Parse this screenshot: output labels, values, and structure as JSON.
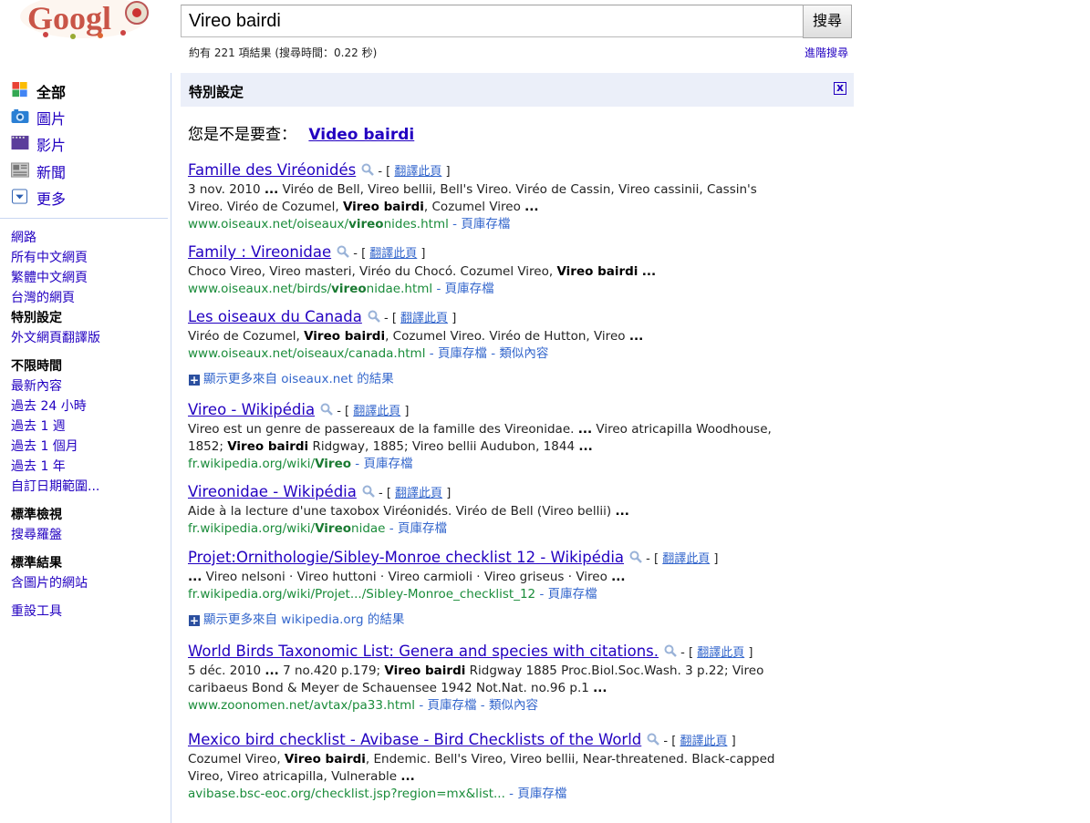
{
  "search": {
    "query": "Vireo bairdi",
    "button_label": "搜尋"
  },
  "stats": "約有 221 項結果 (搜尋時間：0.22 秒)",
  "advanced_search": "進階搜尋",
  "nav": {
    "main": [
      {
        "label": "全部",
        "icon": "google-all-icon"
      },
      {
        "label": "圖片",
        "icon": "camera-icon"
      },
      {
        "label": "影片",
        "icon": "film-icon"
      },
      {
        "label": "新聞",
        "icon": "newspaper-icon"
      },
      {
        "label": "更多",
        "icon": "dropdown-icon"
      }
    ],
    "web": [
      "網路",
      "所有中文網頁",
      "繁體中文網頁",
      "台灣的網頁"
    ],
    "special_settings": "特別設定",
    "translated": "外文網頁翻譯版",
    "time_head": "不限時間",
    "time": [
      "最新內容",
      "過去 24 小時",
      "過去 1 週",
      "過去 1 個月",
      "過去 1 年",
      "自訂日期範圍..."
    ],
    "view_head": "標準檢視",
    "view": [
      "搜尋羅盤"
    ],
    "results_head": "標準結果",
    "results": [
      "含圖片的網站"
    ],
    "reset": "重設工具"
  },
  "settings_bar": {
    "title": "特別設定",
    "close": "x"
  },
  "did_you_mean": {
    "prefix": "您是不是要查：",
    "suggestion": "Video bairdi"
  },
  "translate_label": "翻譯此頁",
  "cache_label": "頁庫存檔",
  "similar_label": "類似內容",
  "results": [
    {
      "title": "Famille des Viréonidés",
      "snippet_html": "3 nov. 2010 <b>...</b> Viréo de Bell, Vireo bellii, Bell's Vireo. Viréo de Cassin, Vireo cassinii, Cassin's Vireo. Viréo de Cozumel, <b>Vireo bairdi</b>, Cozumel Vireo <b>...</b>",
      "url_html": "www.oiseaux.net/oiseaux/<b>vireo</b>nides.html",
      "similar": false
    },
    {
      "title": "Family : Vireonidae",
      "snippet_html": "Choco Vireo, Vireo masteri, Viréo du Chocó. Cozumel Vireo, <b>Vireo bairdi</b> <b>...</b>",
      "url_html": "www.oiseaux.net/birds/<b>vireo</b>nidae.html",
      "similar": false
    },
    {
      "title": "Les oiseaux du Canada",
      "snippet_html": "Viréo de Cozumel, <b>Vireo bairdi</b>, Cozumel Vireo. Viréo de Hutton, Vireo <b>...</b>",
      "url_html": "www.oiseaux.net/oiseaux/canada.html",
      "similar": true
    },
    {
      "title": "Vireo - Wikipédia",
      "snippet_html": "Vireo est un genre de passereaux de la famille des Vireonidae. <b>...</b> Vireo atricapilla Woodhouse, 1852; <b>Vireo bairdi</b> Ridgway, 1885; Vireo bellii Audubon, 1844 <b>...</b>",
      "url_html": "fr.wikipedia.org/wiki/<b>Vireo</b>",
      "similar": false
    },
    {
      "title": "Vireonidae - Wikipédia",
      "snippet_html": "Aide à la lecture d'une taxobox Viréonidés. Viréo de Bell (Vireo bellii) <b>...</b>",
      "url_html": "fr.wikipedia.org/wiki/<b>Vireo</b>nidae",
      "similar": false
    },
    {
      "title": "Projet:Ornithologie/Sibley-Monroe checklist 12 - Wikipédia",
      "snippet_html": "<b>...</b> Vireo nelsoni · Vireo huttoni · Vireo carmioli · Vireo griseus · Vireo <b>...</b>",
      "url_html": "fr.wikipedia.org/wiki/Projet.../Sibley-Monroe_checklist_12",
      "similar": false
    },
    {
      "title": "World Birds Taxonomic List: Genera and species with citations.",
      "snippet_html": "5 déc. 2010 <b>...</b> 7 no.420 p.179; <b>Vireo bairdi</b> Ridgway 1885 Proc.Biol.Soc.Wash. 3 p.22; Vireo caribaeus Bond &amp; Meyer de Schauensee 1942 Not.Nat. no.96 p.1 <b>...</b>",
      "url_html": "www.zoonomen.net/avtax/pa33.html",
      "similar": true
    },
    {
      "title": "Mexico bird checklist - Avibase - Bird Checklists of the World",
      "snippet_html": "Cozumel Vireo, <b>Vireo bairdi</b>, Endemic. Bell's Vireo, Vireo bellii, Near-threatened. Black-capped Vireo, Vireo atricapilla, Vulnerable <b>...</b>",
      "url_html": "avibase.bsc-eoc.org/checklist.jsp?region=mx&amp;list...",
      "similar": false
    }
  ],
  "more_from": [
    "顯示更多來自 oiseaux.net 的結果",
    "顯示更多來自 wikipedia.org 的結果"
  ]
}
